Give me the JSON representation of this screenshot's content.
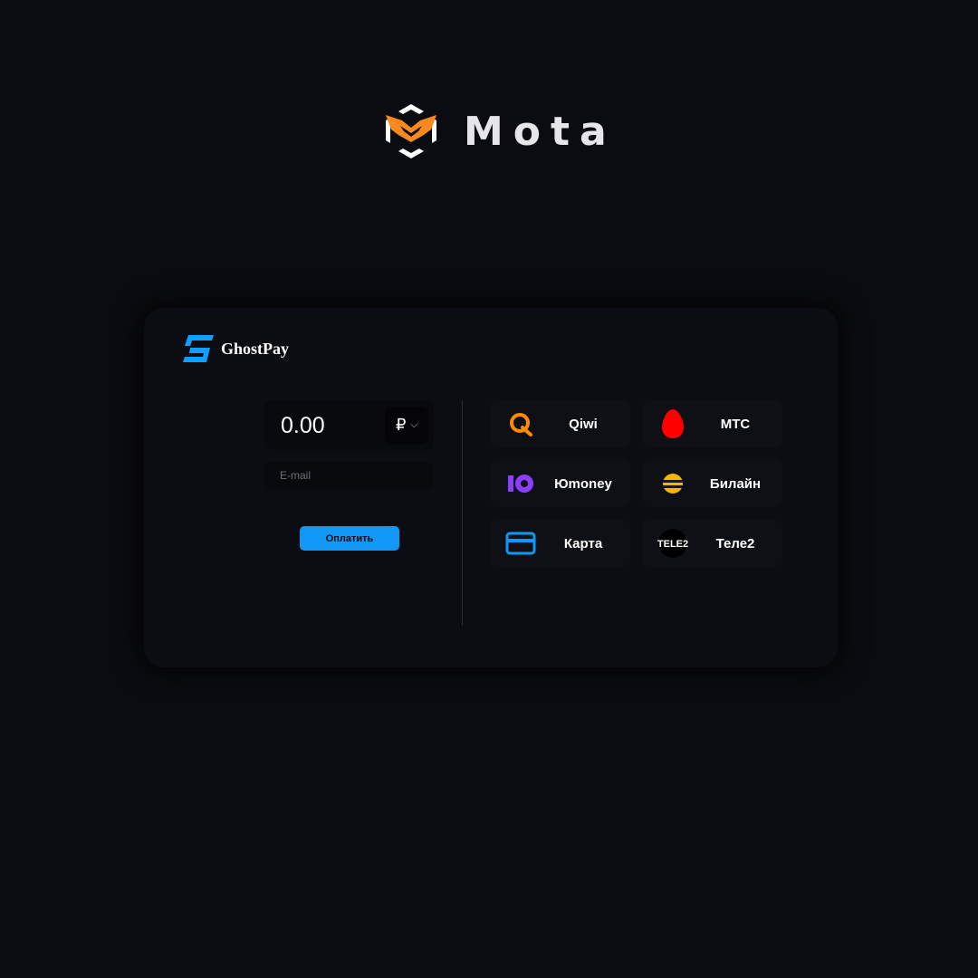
{
  "brand": {
    "name": "Mota"
  },
  "gateway": {
    "name": "GhostPay"
  },
  "form": {
    "amount": "0.00",
    "currency_symbol": "₽",
    "email_placeholder": "E-mail",
    "pay_label": "Оплатить"
  },
  "methods": [
    {
      "label": "Qiwi",
      "icon": "qiwi-icon"
    },
    {
      "label": "МТС",
      "icon": "mts-egg-icon"
    },
    {
      "label": "Юmoney",
      "icon": "yoomoney-icon"
    },
    {
      "label": "Билайн",
      "icon": "beeline-icon"
    },
    {
      "label": "Карта",
      "icon": "card-icon"
    },
    {
      "label": "Теле2",
      "icon": "tele2-icon",
      "icon_text": "TELE2"
    }
  ],
  "colors": {
    "background": "#0b0c11",
    "accent": "#1197f5",
    "logo_orange": "#f7891f",
    "qiwi": "#ff8c00",
    "mts": "#ff0000",
    "yoomoney": "#8b3ffd",
    "beeline": "#f5b800"
  }
}
